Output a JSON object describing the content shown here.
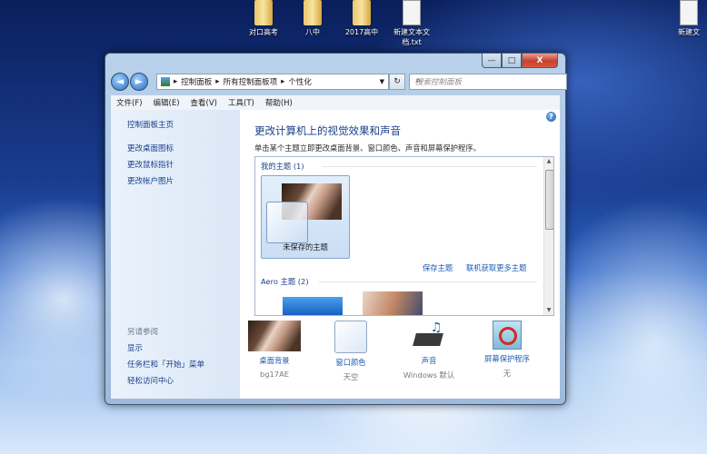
{
  "desktop": {
    "icons": [
      {
        "label": "对口高考"
      },
      {
        "label": "八中"
      },
      {
        "label": "2017高中"
      },
      {
        "label": "新建文本文档.txt"
      },
      {
        "label": "新建文"
      }
    ]
  },
  "window": {
    "controls": {
      "minimize": "—",
      "maximize": "□",
      "close": "X"
    },
    "nav": {
      "back": "◄",
      "forward": "►"
    },
    "address": {
      "segments": [
        "控制面板",
        "所有控制面板项",
        "个性化"
      ],
      "separator": "▸"
    },
    "refresh": "↻",
    "search": {
      "placeholder": "搜索控制面板"
    },
    "menu": [
      "文件(F)",
      "编辑(E)",
      "查看(V)",
      "工具(T)",
      "帮助(H)"
    ],
    "left_pane": {
      "home": "控制面板主页",
      "links": [
        "更改桌面图标",
        "更改鼠标指针",
        "更改帐户图片"
      ],
      "see_also_heading": "另请参阅",
      "see_also": [
        "显示",
        "任务栏和「开始」菜单",
        "轻松访问中心"
      ]
    },
    "main": {
      "title": "更改计算机上的视觉效果和声音",
      "subtitle": "单击某个主题立即更改桌面背景、窗口颜色、声音和屏幕保护程序。",
      "help": "?",
      "my_themes_heading": "我的主题 (1)",
      "unsaved_theme": "未保存的主题",
      "save_theme": "保存主题",
      "get_more": "联机获取更多主题",
      "aero_heading": "Aero 主题 (2)"
    },
    "bottom": [
      {
        "label": "桌面背景",
        "value": "bg17AE"
      },
      {
        "label": "窗口颜色",
        "value": "天空"
      },
      {
        "label": "声音",
        "value": "Windows 默认"
      },
      {
        "label": "屏幕保护程序",
        "value": "无"
      }
    ]
  }
}
